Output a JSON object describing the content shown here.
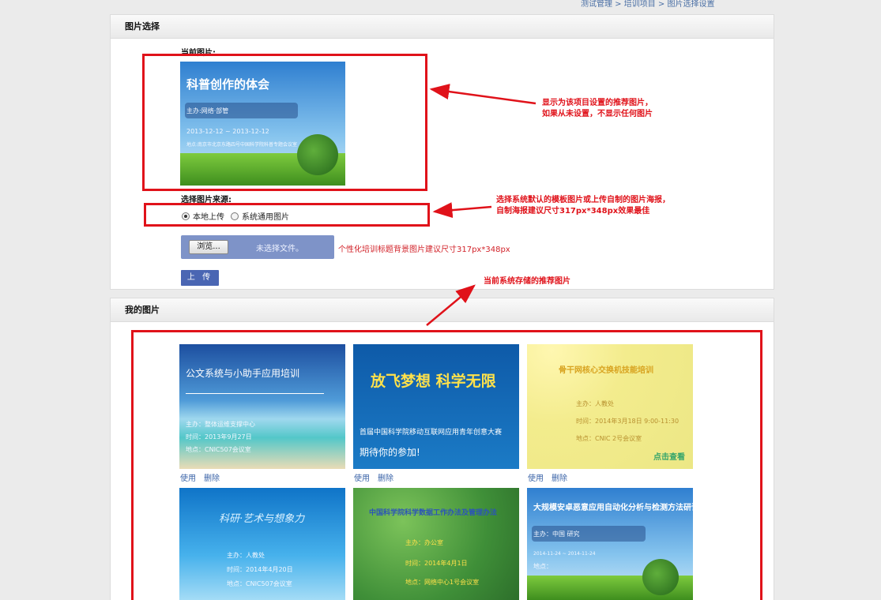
{
  "breadcrumb": "测试管理 > 培训项目 > 图片选择设置",
  "section1": {
    "title": "图片选择",
    "current_label": "当前图片:",
    "source_label": "选择图片来源:",
    "radio_local": "本地上传",
    "radio_system": "系统通用图片",
    "browse": "浏览...",
    "no_file": "未选择文件。",
    "hint": "个性化培训标题背景图片建议尺寸317px*348px",
    "upload": "上 传"
  },
  "current_poster": {
    "title": "科普创作的体会",
    "host": "主办:网络·部管",
    "date": "2013-12-12 ~ 2013-12-12",
    "place": "地点:南京市北京东路四号中国科学院科普专题会议室"
  },
  "annotations": {
    "note1_line1": "显示为该项目设置的推荐图片，",
    "note1_line2": "如果从未设置，不显示任何图片",
    "note2_line1": "选择系统默认的模板图片或上传自制的图片海报，",
    "note2_line2": "自制海报建议尺寸317px*348px效果最佳",
    "note3": "当前系统存储的推荐图片"
  },
  "section2": {
    "title": "我的图片",
    "use": "使用",
    "delete": "删除",
    "posters": [
      {
        "title": "公文系统与小助手应用培训",
        "l1": "主办：整体运维支撑中心",
        "l2": "时间：2013年9月27日",
        "l3": "地点：CNIC507会议室"
      },
      {
        "title": "放飞梦想  科学无限",
        "l1": "首届中国科学院移动互联网应用青年创意大赛",
        "l2": "期待你的参加!",
        "l3": ""
      },
      {
        "title": "骨干网核心交换机技能培训",
        "l1": "主办：人教处",
        "l2": "时间：2014年3月18日 9:00-11:30",
        "l3": "地点：CNIC 2号会议室",
        "badge": "点击查看"
      },
      {
        "title": "科研·艺术与想象力",
        "l1": "主办：人教处",
        "l2": "时间：2014年4月20日",
        "l3": "地点：CNIC507会议室"
      },
      {
        "title": "中国科学院科学数据工作办法及管理办法",
        "l1": "主办：办公室",
        "l2": "时间：2014年4月1日",
        "l3": "地点：网络中心1号会议室"
      },
      {
        "title": "大规模安卓恶意应用自动化分析与检测方法研讨",
        "l1": "主办：中国 研究",
        "l2": "2014-11-24 ~ 2014-11-24",
        "l3": "地点："
      }
    ]
  },
  "colors": {
    "accent_red": "#e0121a",
    "button_blue": "#4a66b3",
    "link_blue": "#3b64a8"
  }
}
